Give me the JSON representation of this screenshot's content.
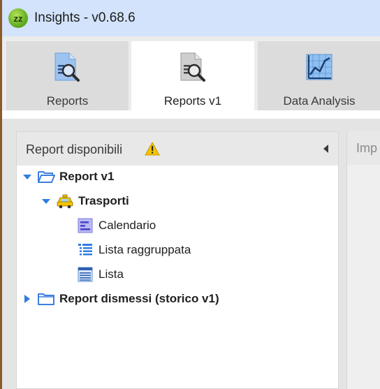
{
  "titlebar": {
    "title": "Insights - v0.68.6",
    "logo_text": "zz"
  },
  "tabs": [
    {
      "label": "Reports",
      "icon": "report-search-icon",
      "active": false
    },
    {
      "label": "Reports v1",
      "icon": "report-search-icon",
      "active": true
    },
    {
      "label": "Data Analysis",
      "icon": "chart-icon",
      "active": false
    }
  ],
  "left_panel": {
    "title": "Report disponibili",
    "warning_icon": "warning-icon",
    "collapse_icon": "collapse-left-icon"
  },
  "right_panel": {
    "title": "Imp"
  },
  "tree": {
    "root1": {
      "label": "Report v1",
      "expanded": true
    },
    "group1": {
      "label": "Trasporti",
      "expanded": true
    },
    "items": [
      {
        "label": "Calendario",
        "icon": "calendar-icon"
      },
      {
        "label": "Lista raggruppata",
        "icon": "grouped-list-icon"
      },
      {
        "label": "Lista",
        "icon": "list-icon"
      }
    ],
    "root2": {
      "label": "Report dismessi (storico v1)",
      "expanded": false
    }
  },
  "colors": {
    "titlebar_bg": "#d3e3fb",
    "accent_blue": "#2f7de1",
    "folder_blue": "#3d7fe0",
    "warning_yellow": "#f5c400"
  }
}
